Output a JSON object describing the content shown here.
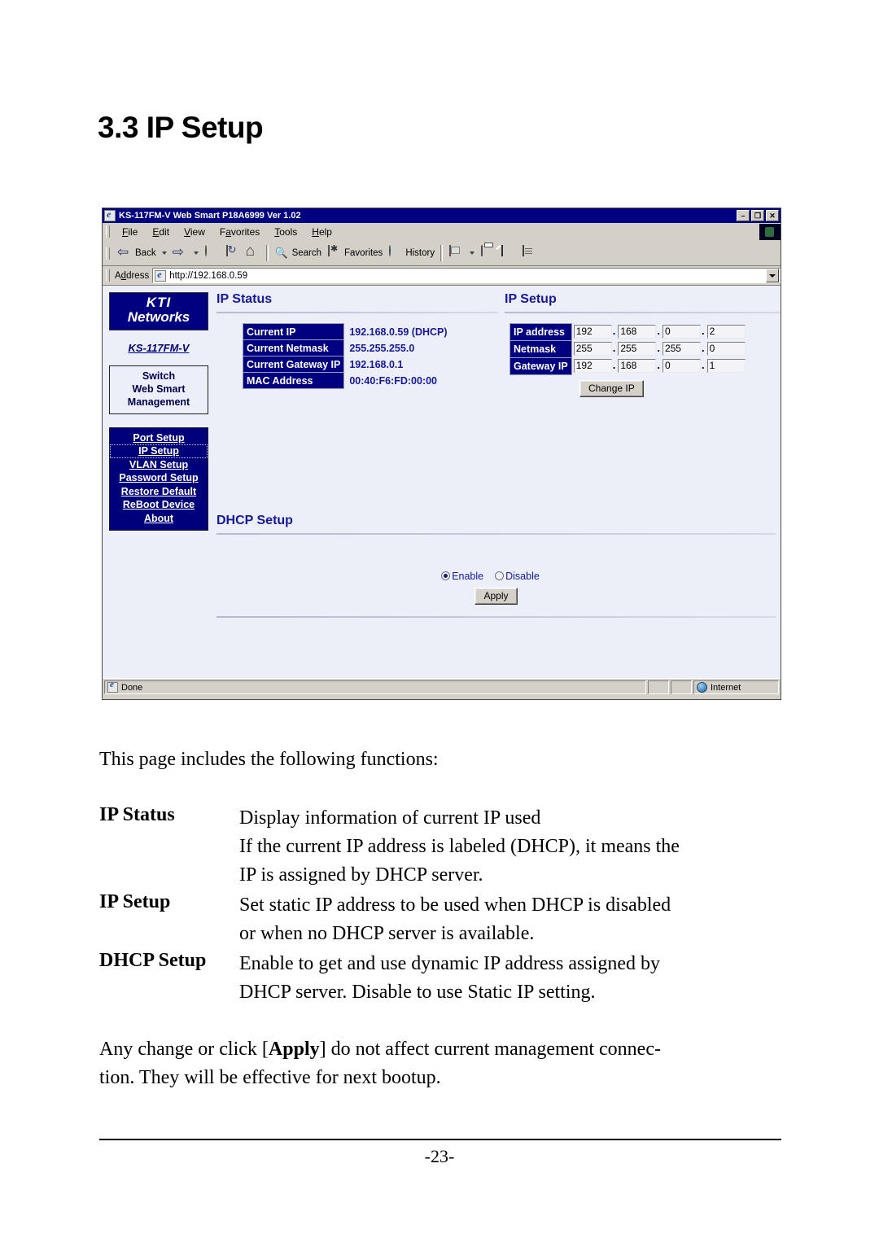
{
  "document": {
    "heading": "3.3 IP Setup",
    "intro": "This page includes the following functions:",
    "definitions": [
      {
        "term": "IP Status",
        "lines": [
          "Display information of current IP used",
          "If the current IP address is labeled (DHCP), it means the",
          "IP is assigned by DHCP server."
        ]
      },
      {
        "term": "IP Setup",
        "lines": [
          "Set static IP address to be used when DHCP is disabled",
          "or when no DHCP server is available."
        ]
      },
      {
        "term": "DHCP Setup",
        "lines": [
          "Enable to get and use dynamic IP address assigned by",
          "DHCP server. Disable to use Static IP setting."
        ]
      }
    ],
    "final_paragraph_pre": "Any change or click [",
    "final_paragraph_bold": "Apply",
    "final_paragraph_post": "] do not affect current management connec-",
    "final_paragraph_line2": "tion. They will be effective for next bootup.",
    "page_number": "-23-"
  },
  "browser": {
    "title": "KS-117FM-V Web Smart P18A6999 Ver 1.02",
    "window_buttons": {
      "minimize": "–",
      "restore": "❐",
      "close": "✕"
    },
    "menus": [
      "File",
      "Edit",
      "View",
      "Favorites",
      "Tools",
      "Help"
    ],
    "toolbar": {
      "back": "Back",
      "search": "Search",
      "favorites": "Favorites",
      "history": "History"
    },
    "address": {
      "label": "Address",
      "url": "http://192.168.0.59"
    },
    "statusbar": {
      "text": "Done",
      "zone": "Internet"
    }
  },
  "webpage": {
    "sidebar": {
      "logo_line1": "KTI",
      "logo_line2": "Networks",
      "model": "KS-117FM-V",
      "subtitle_lines": [
        "Switch",
        "Web Smart",
        "Management"
      ],
      "nav_items": [
        {
          "label": "Port Setup",
          "selected": false
        },
        {
          "label": "IP Setup",
          "selected": true
        },
        {
          "label": "VLAN Setup",
          "selected": false
        },
        {
          "label": "Password Setup",
          "selected": false
        },
        {
          "label": "Restore Default",
          "selected": false
        },
        {
          "label": "ReBoot Device",
          "selected": false
        },
        {
          "label": "About",
          "selected": false
        }
      ]
    },
    "ip_status": {
      "title": "IP Status",
      "rows": [
        {
          "label": "Current IP",
          "value": "192.168.0.59 (DHCP)"
        },
        {
          "label": "Current Netmask",
          "value": "255.255.255.0"
        },
        {
          "label": "Current Gateway IP",
          "value": "192.168.0.1"
        },
        {
          "label": "MAC Address",
          "value": "00:40:F6:FD:00:00"
        }
      ]
    },
    "ip_setup": {
      "title": "IP Setup",
      "rows": [
        {
          "label": "IP address",
          "octets": [
            "192",
            "168",
            "0",
            "2"
          ]
        },
        {
          "label": "Netmask",
          "octets": [
            "255",
            "255",
            "255",
            "0"
          ]
        },
        {
          "label": "Gateway IP",
          "octets": [
            "192",
            "168",
            "0",
            "1"
          ]
        }
      ],
      "button": "Change IP",
      "separator": "."
    },
    "dhcp_setup": {
      "title": "DHCP Setup",
      "options": [
        {
          "label": "Enable",
          "selected": true
        },
        {
          "label": "Disable",
          "selected": false
        }
      ],
      "button": "Apply"
    }
  },
  "colors": {
    "navy": "#000080",
    "link_navy": "#00007a",
    "heading_blue": "#16189c",
    "page_bg": "#eceef8",
    "chrome": "#d4d0c8"
  }
}
